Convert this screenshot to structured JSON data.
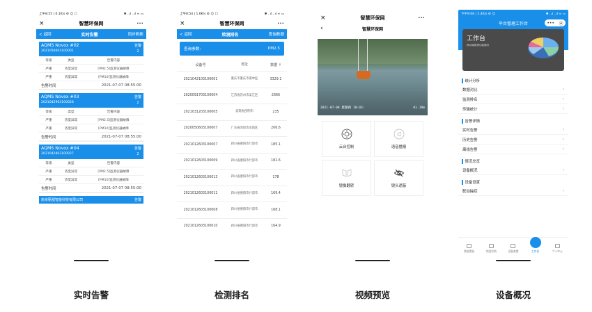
{
  "phone1": {
    "status_left": "上午8:55 | 0.1K/s ⚙ ☺ ☐",
    "status_right": "✱ ..ıl ..ıl ≈ ▭",
    "app_title": "智慧环保网",
    "back": "< 返回",
    "page_title": "实时告警",
    "action": "同步刷新",
    "cards": [
      {
        "name": "AQMS Novox #02",
        "code": "2021050603100001",
        "level_label": "告警",
        "level_num": "2",
        "cols": [
          "等级",
          "类型",
          "告警内容"
        ],
        "rows": [
          [
            "严重",
            "浓度异常",
            "[PM2.5]监测仪器故障"
          ],
          [
            "严重",
            "浓度异常",
            "[PM10]监测仪器故障"
          ]
        ],
        "time_label": "告警时间",
        "time": "2021-07-07 08:55:00"
      },
      {
        "name": "AQMS Novox #03",
        "code": "2021042903100028",
        "level_label": "告警",
        "level_num": "2",
        "cols": [
          "等级",
          "类型",
          "告警内容"
        ],
        "rows": [
          [
            "严重",
            "浓度异常",
            "[PM2.5]监测仪器故障"
          ],
          [
            "严重",
            "浓度异常",
            "[PM10]监测仪器故障"
          ]
        ],
        "time_label": "告警时间",
        "time": "2021-07-07 08:55:00"
      },
      {
        "name": "AQMS Novox #04",
        "code": "2021042803100027",
        "level_label": "告警",
        "level_num": "2",
        "cols": [
          "等级",
          "类型",
          "告警内容"
        ],
        "rows": [
          [
            "严重",
            "浓度异常",
            "[PM2.5]监测仪器故障"
          ],
          [
            "严重",
            "浓度异常",
            "[PM10]监测仪器故障"
          ]
        ],
        "time_label": "告警时间",
        "time": "2021-07-07 08:55:00"
      }
    ],
    "last_card_name": "南京甄视智能科技有限公司",
    "last_card_level": "告警",
    "caption": "实时告警"
  },
  "phone2": {
    "status_left": "上午8:54 | 1.6K/s ⚙ ☺ ☐",
    "status_right": "✱ ..ıl ..ıl ≈ ▭",
    "app_title": "智慧环保网",
    "back": "< 返回",
    "page_title": "检测排名",
    "action": "查询数据",
    "query_label": "查询参数:",
    "query_value": "PM2.5",
    "cols": [
      "设备号",
      "地址",
      "数据 ↑"
    ],
    "rows": [
      [
        "2021042103100001",
        "重庆市重庆市渝中区",
        "3329.1"
      ],
      [
        "2020091703100004",
        "江苏省苏州市吴江区",
        "2666"
      ],
      [
        "2021031203100005",
        "云南省昆明市",
        "235"
      ],
      [
        "2020050603100007",
        "广东省深圳市龙岗区",
        "206.6"
      ],
      [
        "2021012603100007",
        "四川省德阳市什邡市",
        "185.1"
      ],
      [
        "2021012603100009",
        "四川省德阳市什邡市",
        "182.6"
      ],
      [
        "2021012603100013",
        "四川省德阳市什邡市",
        "178"
      ],
      [
        "2021012603100011",
        "四川省德阳市什邡市",
        "169.4"
      ],
      [
        "2021012603100008",
        "四川省德阳市什邡市",
        "168.1"
      ],
      [
        "2021012603100010",
        "四川省德阳市什邡市",
        "164.9"
      ]
    ],
    "caption": "检测排名"
  },
  "phone3": {
    "app_title": "智慧环保网",
    "page_title": "智慧环保网",
    "osd_left": "2021-07-08 星期四 10:03:",
    "osd_right": "01.19m",
    "controls": [
      "云台控制",
      "语音播报",
      "镜像翻转",
      "镜头遮蔽"
    ],
    "caption": "视频预览"
  },
  "phone4": {
    "status_left": "下午9:06 | 5.4K/s ⚙ ☺",
    "status_right": "✱ ..ıl ..ıl ≈ ▭",
    "page_title": "平台管理工作台",
    "pill_dots": "•••",
    "dash_title": "工作台",
    "dash_sub": "移动端管理功能模块",
    "sections": [
      {
        "title": "统计分析",
        "items": [
          "数据对比",
          "监测排名",
          "传输统计"
        ]
      },
      {
        "title": "告警详情",
        "items": [
          "实时告警",
          "历史告警",
          "离线告警"
        ]
      },
      {
        "title": "情况总览",
        "items": [
          "设备概况"
        ]
      },
      {
        "title": "设备设置",
        "items": [
          "联动操控"
        ]
      }
    ],
    "tabs": [
      "数据看板",
      "地图导航",
      "设备查看",
      "工作台",
      "个人中心"
    ],
    "active_tab": 3,
    "caption": "设备概况"
  },
  "colors": {
    "accent": "#1a8fe9"
  }
}
